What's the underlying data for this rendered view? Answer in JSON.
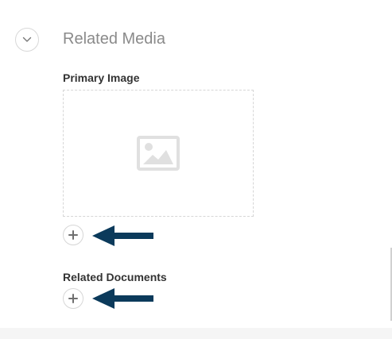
{
  "section": {
    "title": "Related Media",
    "toggle_icon": "chevron-down-icon"
  },
  "primary_image": {
    "label": "Primary Image",
    "placeholder_icon": "image-placeholder-icon",
    "add_icon": "plus-icon"
  },
  "related_documents": {
    "label": "Related Documents",
    "add_icon": "plus-icon"
  },
  "annotation": {
    "arrow_icon": "arrow-left-icon",
    "color": "#0b3a5b"
  },
  "colors": {
    "label": "#333333",
    "title": "#8a8a8a",
    "border": "#d6d6d6",
    "icon": "#7a7a7a"
  }
}
